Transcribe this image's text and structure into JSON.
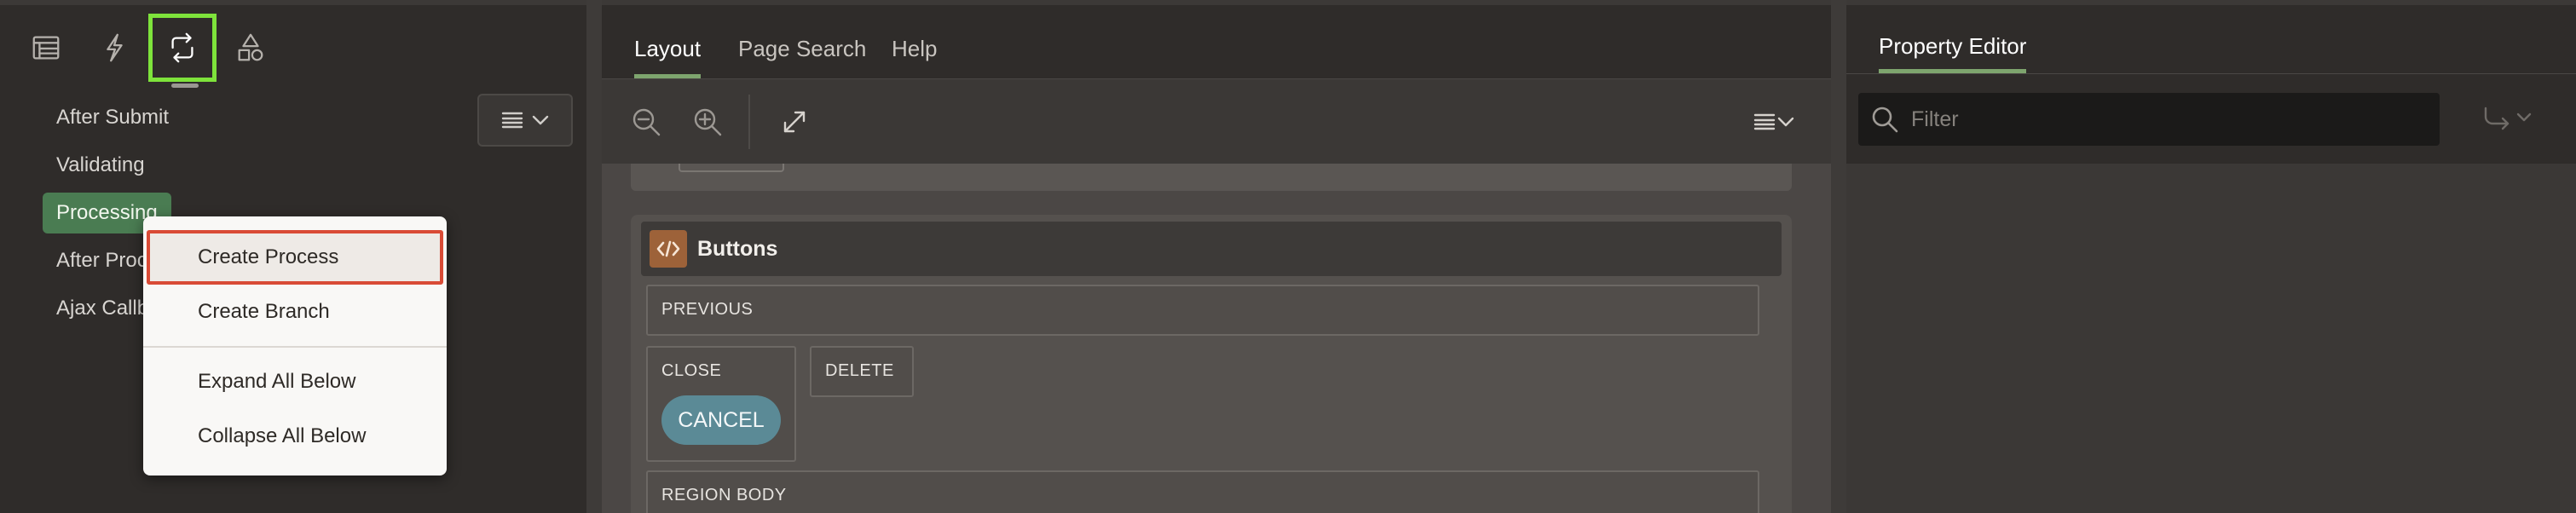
{
  "left": {
    "tabs": [
      {
        "name": "rendering",
        "icon": "rendering-tree-icon"
      },
      {
        "name": "dynamic-actions",
        "icon": "lightning-icon"
      },
      {
        "name": "processing",
        "icon": "processing-loop-icon",
        "active": true
      },
      {
        "name": "shared-components",
        "icon": "shapes-icon"
      }
    ],
    "tree": [
      {
        "label": "After Submit"
      },
      {
        "label": "Validating"
      },
      {
        "label": "Processing",
        "selected": true
      },
      {
        "label": "After Proc"
      },
      {
        "label": "Ajax Callb"
      }
    ],
    "menu_button_icon": "list-menu-icon"
  },
  "context_menu": {
    "items": [
      {
        "label": "Create Process",
        "highlighted": true
      },
      {
        "label": "Create Branch"
      },
      {
        "label": "Expand All Below"
      },
      {
        "label": "Collapse All Below"
      }
    ]
  },
  "center": {
    "tabs": [
      {
        "label": "Layout",
        "active": true
      },
      {
        "label": "Page Search"
      },
      {
        "label": "Help"
      }
    ],
    "toolbar_icons": [
      "zoom-out-icon",
      "zoom-in-icon",
      "expand-icon",
      "list-menu-icon"
    ],
    "region": {
      "title": "Buttons",
      "slots": {
        "previous": "PREVIOUS",
        "close": "CLOSE",
        "delete": "DELETE",
        "region_body": "REGION BODY"
      },
      "cancel_label": "CANCEL"
    }
  },
  "right": {
    "tab_label": "Property Editor",
    "filter_placeholder": "Filter"
  },
  "colors": {
    "accent_green": "#7ea56e",
    "selected_tab_outline": "#7ee33b",
    "highlight_outline": "#d94b36",
    "selected_tree_item": "#4a7c52",
    "button_teal": "#5b8a96",
    "region_icon": "#9d6239"
  }
}
